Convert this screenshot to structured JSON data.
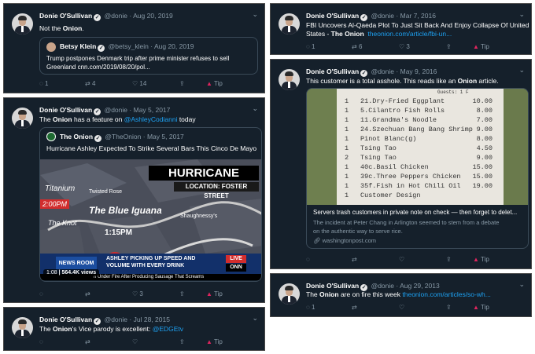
{
  "tweets": [
    {
      "name": "Donie O'Sullivan",
      "handle": "@donie",
      "date": "Aug 20, 2019",
      "text_a": "Not the ",
      "text_b": "Onion",
      "text_c": ".",
      "quote": {
        "name": "Betsy Klein",
        "handle": "@betsy_klein",
        "date": "Aug 20, 2019",
        "line1": "Trump postpones Denmark trip after prime minister refuses to sell",
        "line2": "Greenland cnn.com/2019/08/20/pol..."
      },
      "replies": "1",
      "retweets": "4",
      "likes": "14",
      "tip": "Tip"
    },
    {
      "name": "Donie O'Sullivan",
      "handle": "@donie",
      "date": "May 5, 2017",
      "text_a": "The ",
      "text_b": "Onion",
      "text_c": " has a feature on ",
      "mention": "@AshleyCodianni",
      "text_d": " today",
      "quote": {
        "name": "The Onion",
        "handle": "@TheOnion",
        "date": "May 5, 2017",
        "line1": "Hurricane Ashley Expected To Strike Several Bars This Cinco De Mayo"
      },
      "media": {
        "headline": "HURRICANE ASHLEY",
        "location": "LOCATION: FOSTER STREET",
        "places": [
          "Titanium",
          "Twisted Rose",
          "2:00PM",
          "The Blue Iguana",
          "Shaughnessy's",
          "The Knot",
          "1:15PM"
        ],
        "ticker1": "ASHLEY PICKING UP SPEED AND",
        "ticker2": "VOLUME WITH EVERY DRINK",
        "crawl": "n Under Fire After Producing Sausage That Screams",
        "news_logo": "NEWS ROOM",
        "live": "LIVE",
        "network": "ONN",
        "duration": "1:08",
        "views": "564.4K views"
      },
      "replies": "",
      "retweets": "",
      "likes": "3",
      "tip": "Tip"
    },
    {
      "name": "Donie O'Sullivan",
      "handle": "@donie",
      "date": "Jul 28, 2015",
      "text_a": "The ",
      "text_b": "Onion",
      "text_c": "'s Vice parody is excellent: ",
      "mention": "@EDGEtv",
      "tip": "Tip"
    },
    {
      "name": "Donie O'Sullivan",
      "handle": "@donie",
      "date": "Mar 7, 2016",
      "line1": "FBI Uncovers Al-Qaeda Plot To Just Sit Back And Enjoy Collapse Of United",
      "line2_a": "States - ",
      "line2_b": "The Onion",
      "line2_link": "theonion.com/article/fbi-un...",
      "replies": "1",
      "retweets": "6",
      "likes": "3",
      "tip": "Tip"
    },
    {
      "name": "Donie O'Sullivan",
      "handle": "@donie",
      "date": "May 9, 2016",
      "text_a": "This customer is a total asshole. This reads like an ",
      "text_b": "Onion",
      "text_c": " article.",
      "receipt": {
        "top": "Guests: 1 F",
        "lines": [
          {
            "q": "1",
            "item": "21.Dry-Fried Eggplant",
            "price": "10.00"
          },
          {
            "q": "1",
            "item": "5.Cilantro Fish Rolls",
            "price": "8.00"
          },
          {
            "q": "1",
            "item": "11.Grandma's Noodle",
            "price": "7.00"
          },
          {
            "q": "1",
            "item": "24.Szechuan Bang Bang Shrimp",
            "price": "9.00"
          },
          {
            "q": "1",
            "item": "Pinot Blanc(g)",
            "price": "8.00"
          },
          {
            "q": "1",
            "item": "Tsing Tao",
            "price": "4.50"
          },
          {
            "q": "2",
            "item": "Tsing Tao",
            "price": "9.00"
          },
          {
            "q": "1",
            "item": "40c.Basil Chicken",
            "price": "15.00"
          },
          {
            "q": "1",
            "item": "39c.Three Peppers Chicken",
            "price": "15.00"
          },
          {
            "q": "1",
            "item": "35f.Fish in Hot Chili Oil",
            "price": "19.00"
          },
          {
            "q": "1",
            "item": "Customer Design",
            "price": ""
          }
        ]
      },
      "card_title": "Servers trash customers in private note on check — then forget to delet...",
      "card_desc1": "The incident at Peter Chang in Arlington seemed to stem from a debate",
      "card_desc2": "on the authentic way to serve rice.",
      "card_domain": "washingtonpost.com",
      "replies": "",
      "retweets": "",
      "likes": "",
      "tip": "Tip"
    },
    {
      "name": "Donie O'Sullivan",
      "handle": "@donie",
      "date": "Aug 29, 2013",
      "text_a": "The ",
      "text_b": "Onion",
      "text_c": " are on fire this week ",
      "link": "theonion.com/articles/so-wh...",
      "replies": "1",
      "retweets": "",
      "likes": "",
      "tip": "Tip"
    }
  ],
  "icons": [
    "verified-icon",
    "chevron-down-icon",
    "reply-icon",
    "retweet-icon",
    "like-icon",
    "share-icon",
    "tip-icon",
    "link-icon"
  ],
  "colors": {
    "background": "#15202b",
    "link": "#1da1f2",
    "muted": "#8899a6",
    "tip": "#e0245e"
  }
}
